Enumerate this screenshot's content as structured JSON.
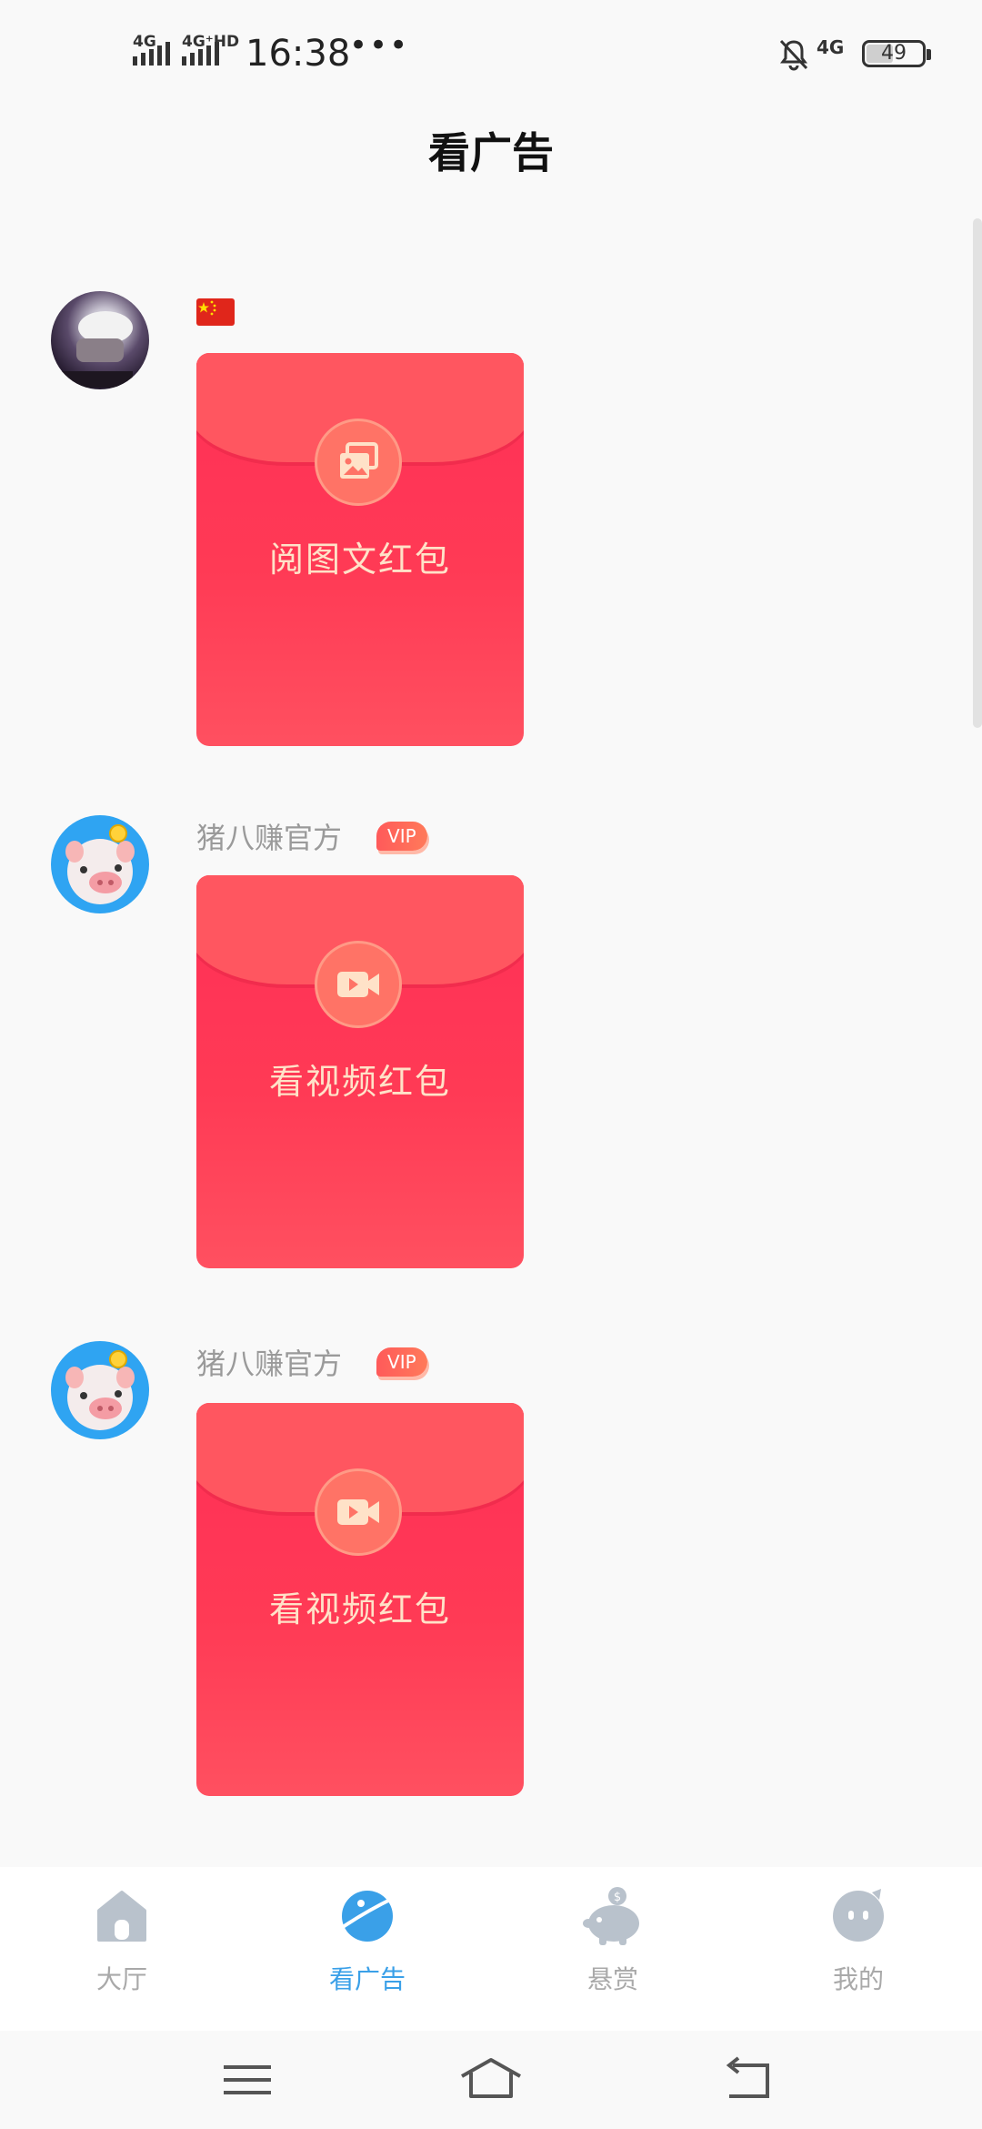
{
  "status": {
    "sim1": "4G",
    "sim2": "4G⁺HD",
    "time": "16:38",
    "more": "•••",
    "network": "4G",
    "battery_pct": "49"
  },
  "header": {
    "title": "看广告"
  },
  "feed": [
    {
      "author": "",
      "vip": "",
      "envelope_label": "阅图文红包",
      "envelope_icon": "image-gallery-icon"
    },
    {
      "author": "猪八赚官方",
      "vip": "VIP",
      "envelope_label": "看视频红包",
      "envelope_icon": "video-camera-icon"
    },
    {
      "author": "猪八赚官方",
      "vip": "VIP",
      "envelope_label": "看视频红包",
      "envelope_icon": "video-camera-icon"
    }
  ],
  "tabs": [
    {
      "label": "大厅",
      "icon": "home-icon"
    },
    {
      "label": "看广告",
      "icon": "planet-icon",
      "active": true
    },
    {
      "label": "悬赏",
      "icon": "piggy-bank-icon"
    },
    {
      "label": "我的",
      "icon": "profile-icon"
    }
  ],
  "colors": {
    "accent": "#3aa0e8",
    "envelope_red": "#ff2f57",
    "envelope_text": "#ffe2c8"
  }
}
